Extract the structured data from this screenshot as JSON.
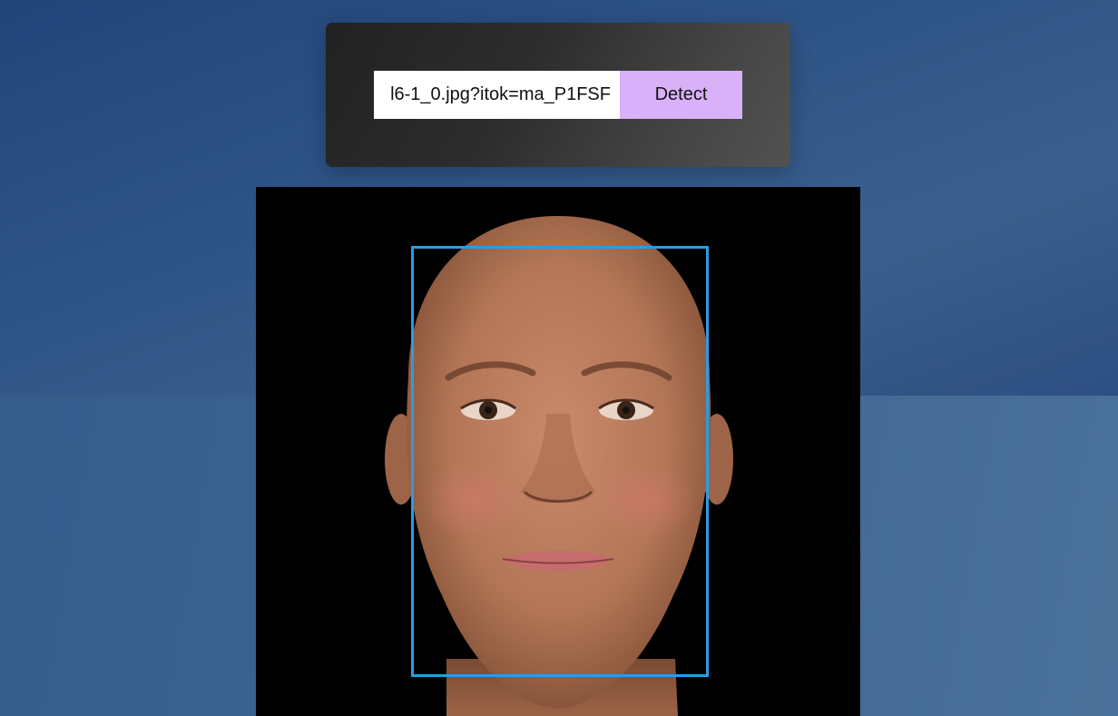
{
  "url_input": {
    "value": "l6-1_0.jpg?itok=ma_P1FSF"
  },
  "detect_button": {
    "label": "Detect"
  },
  "image": {
    "subject": "face-photo",
    "detected_faces": 1
  },
  "colors": {
    "button_bg": "#d8b1f8",
    "box_border": "#2b9be6",
    "panel_bg": "#2c2c2c",
    "page_bg": "#2f5688"
  }
}
